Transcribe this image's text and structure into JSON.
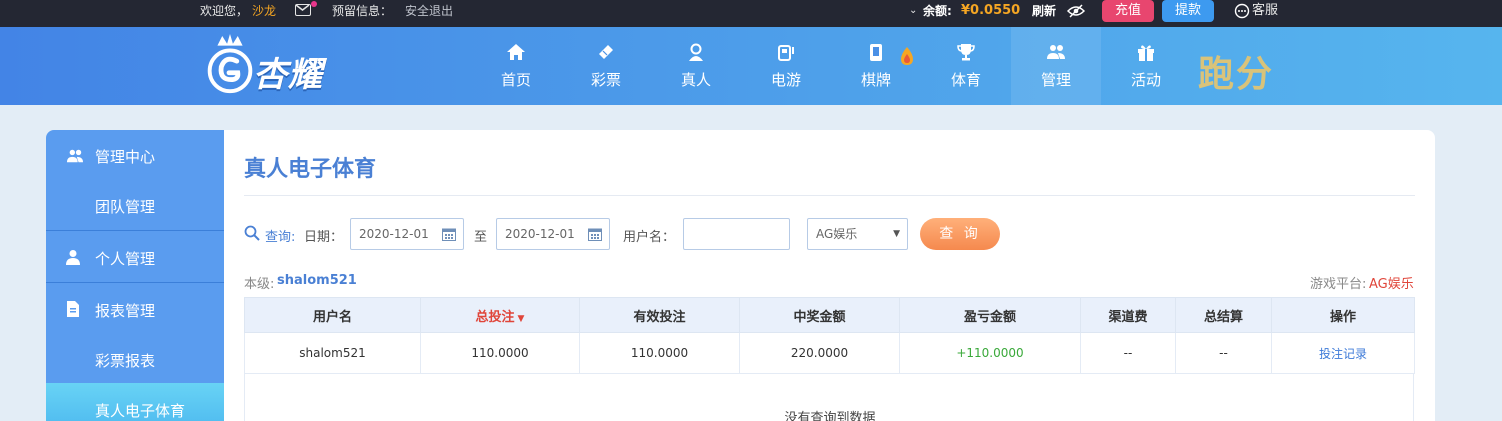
{
  "topbar": {
    "welcome": "欢迎您，",
    "username": "沙龙",
    "reserved_info": "预留信息：",
    "logout": "安全退出",
    "balance_label": "余额:",
    "balance_value": "¥0.0550",
    "refresh": "刷新",
    "deposit": "充值",
    "withdraw": "提款",
    "service": "客服"
  },
  "logo": {
    "text": "杏耀"
  },
  "nav": {
    "items": [
      {
        "label": "首页"
      },
      {
        "label": "彩票"
      },
      {
        "label": "真人"
      },
      {
        "label": "电游"
      },
      {
        "label": "棋牌"
      },
      {
        "label": "体育"
      },
      {
        "label": "管理"
      },
      {
        "label": "活动"
      }
    ],
    "extra": "跑分"
  },
  "sidebar": {
    "items": [
      {
        "label": "管理中心"
      },
      {
        "label": "团队管理"
      },
      {
        "label": "个人管理"
      },
      {
        "label": "报表管理"
      },
      {
        "label": "彩票报表"
      },
      {
        "label": "真人电子体育"
      }
    ]
  },
  "main": {
    "title": "真人电子体育",
    "query_label": "查询:",
    "date_label": "日期：",
    "date_from": "2020-12-01",
    "to_label": "至",
    "date_to": "2020-12-01",
    "username_label": "用户名：",
    "username_value": "",
    "platform_select": "AG娱乐",
    "query_button": "查 询",
    "level_label": "本级:",
    "level_user": "shalom521",
    "platform_label": "游戏平台:",
    "platform_value": "AG娱乐"
  },
  "table": {
    "headers": [
      "用户名",
      "总投注",
      "有效投注",
      "中奖金额",
      "盈亏金额",
      "渠道费",
      "总结算",
      "操作"
    ],
    "rows": [
      [
        "shalom521",
        "110.0000",
        "110.0000",
        "220.0000",
        "+110.0000",
        "--",
        "--",
        "投注记录"
      ]
    ],
    "empty_text": "没有查询到数据"
  },
  "colors": {
    "accent": "#4a80d4",
    "sort_red": "#e0453a",
    "profit_green": "#3aa93a",
    "link_blue": "#3d7ad8",
    "deposit_bg": "#e8466f",
    "withdraw_bg": "#3d9af0"
  }
}
